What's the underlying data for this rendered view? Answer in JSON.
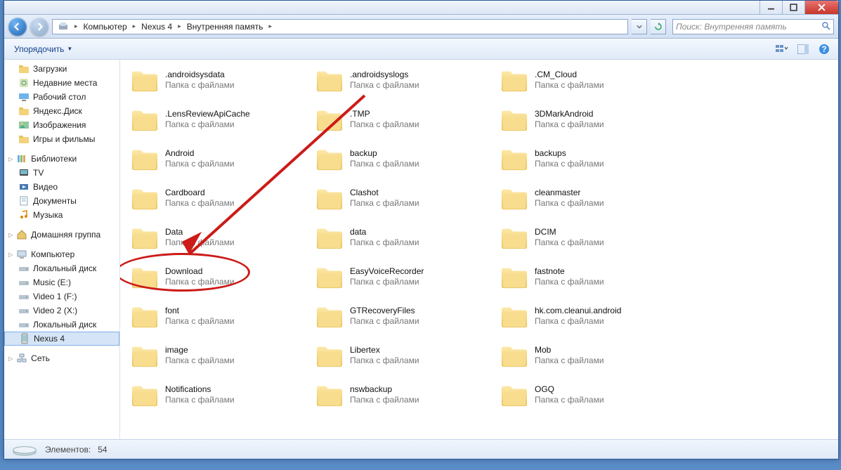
{
  "titlebar": {
    "min": "_",
    "max": "□",
    "close": "✕"
  },
  "breadcrumb": {
    "segs": [
      "Компьютер",
      "Nexus 4",
      "Внутренняя память"
    ]
  },
  "search": {
    "placeholder": "Поиск: Внутренняя память"
  },
  "toolbar": {
    "organize": "Упорядочить"
  },
  "sidebar": {
    "fav": [
      {
        "label": "Загрузки",
        "icon": "folder"
      },
      {
        "label": "Недавние места",
        "icon": "recent"
      },
      {
        "label": "Рабочий стол",
        "icon": "desktop"
      },
      {
        "label": "Яндекс.Диск",
        "icon": "folder"
      },
      {
        "label": "Изображения",
        "icon": "pictures"
      },
      {
        "label": "Игры и фильмы",
        "icon": "folder"
      }
    ],
    "lib_title": "Библиотеки",
    "lib": [
      {
        "label": "TV",
        "icon": "tv"
      },
      {
        "label": "Видео",
        "icon": "video"
      },
      {
        "label": "Документы",
        "icon": "docs"
      },
      {
        "label": "Музыка",
        "icon": "music"
      }
    ],
    "home_title": "Домашняя группа",
    "comp_title": "Компьютер",
    "comp": [
      {
        "label": "Локальный диск",
        "icon": "hdd"
      },
      {
        "label": "Music (E:)",
        "icon": "hdd"
      },
      {
        "label": "Video 1 (F:)",
        "icon": "hdd"
      },
      {
        "label": "Video 2 (X:)",
        "icon": "hdd"
      },
      {
        "label": "Локальный диск",
        "icon": "hdd"
      },
      {
        "label": "Nexus 4",
        "icon": "phone",
        "sel": true
      }
    ],
    "net_title": "Сеть"
  },
  "subtype": "Папка с файлами",
  "folders": [
    ".androidsysdata",
    ".androidsyslogs",
    ".CM_Cloud",
    ".LensReviewApiCache",
    ".TMP",
    "3DMarkAndroid",
    "Android",
    "backup",
    "backups",
    "Cardboard",
    "Clashot",
    "cleanmaster",
    "Data",
    "data",
    "DCIM",
    "Download",
    "EasyVoiceRecorder",
    "fastnote",
    "font",
    "GTRecoveryFiles",
    "hk.com.cleanui.android",
    "image",
    "Libertex",
    "Mob",
    "Notifications",
    "nswbackup",
    "OGQ"
  ],
  "status": {
    "count_label": "Элементов:",
    "count": "54"
  }
}
